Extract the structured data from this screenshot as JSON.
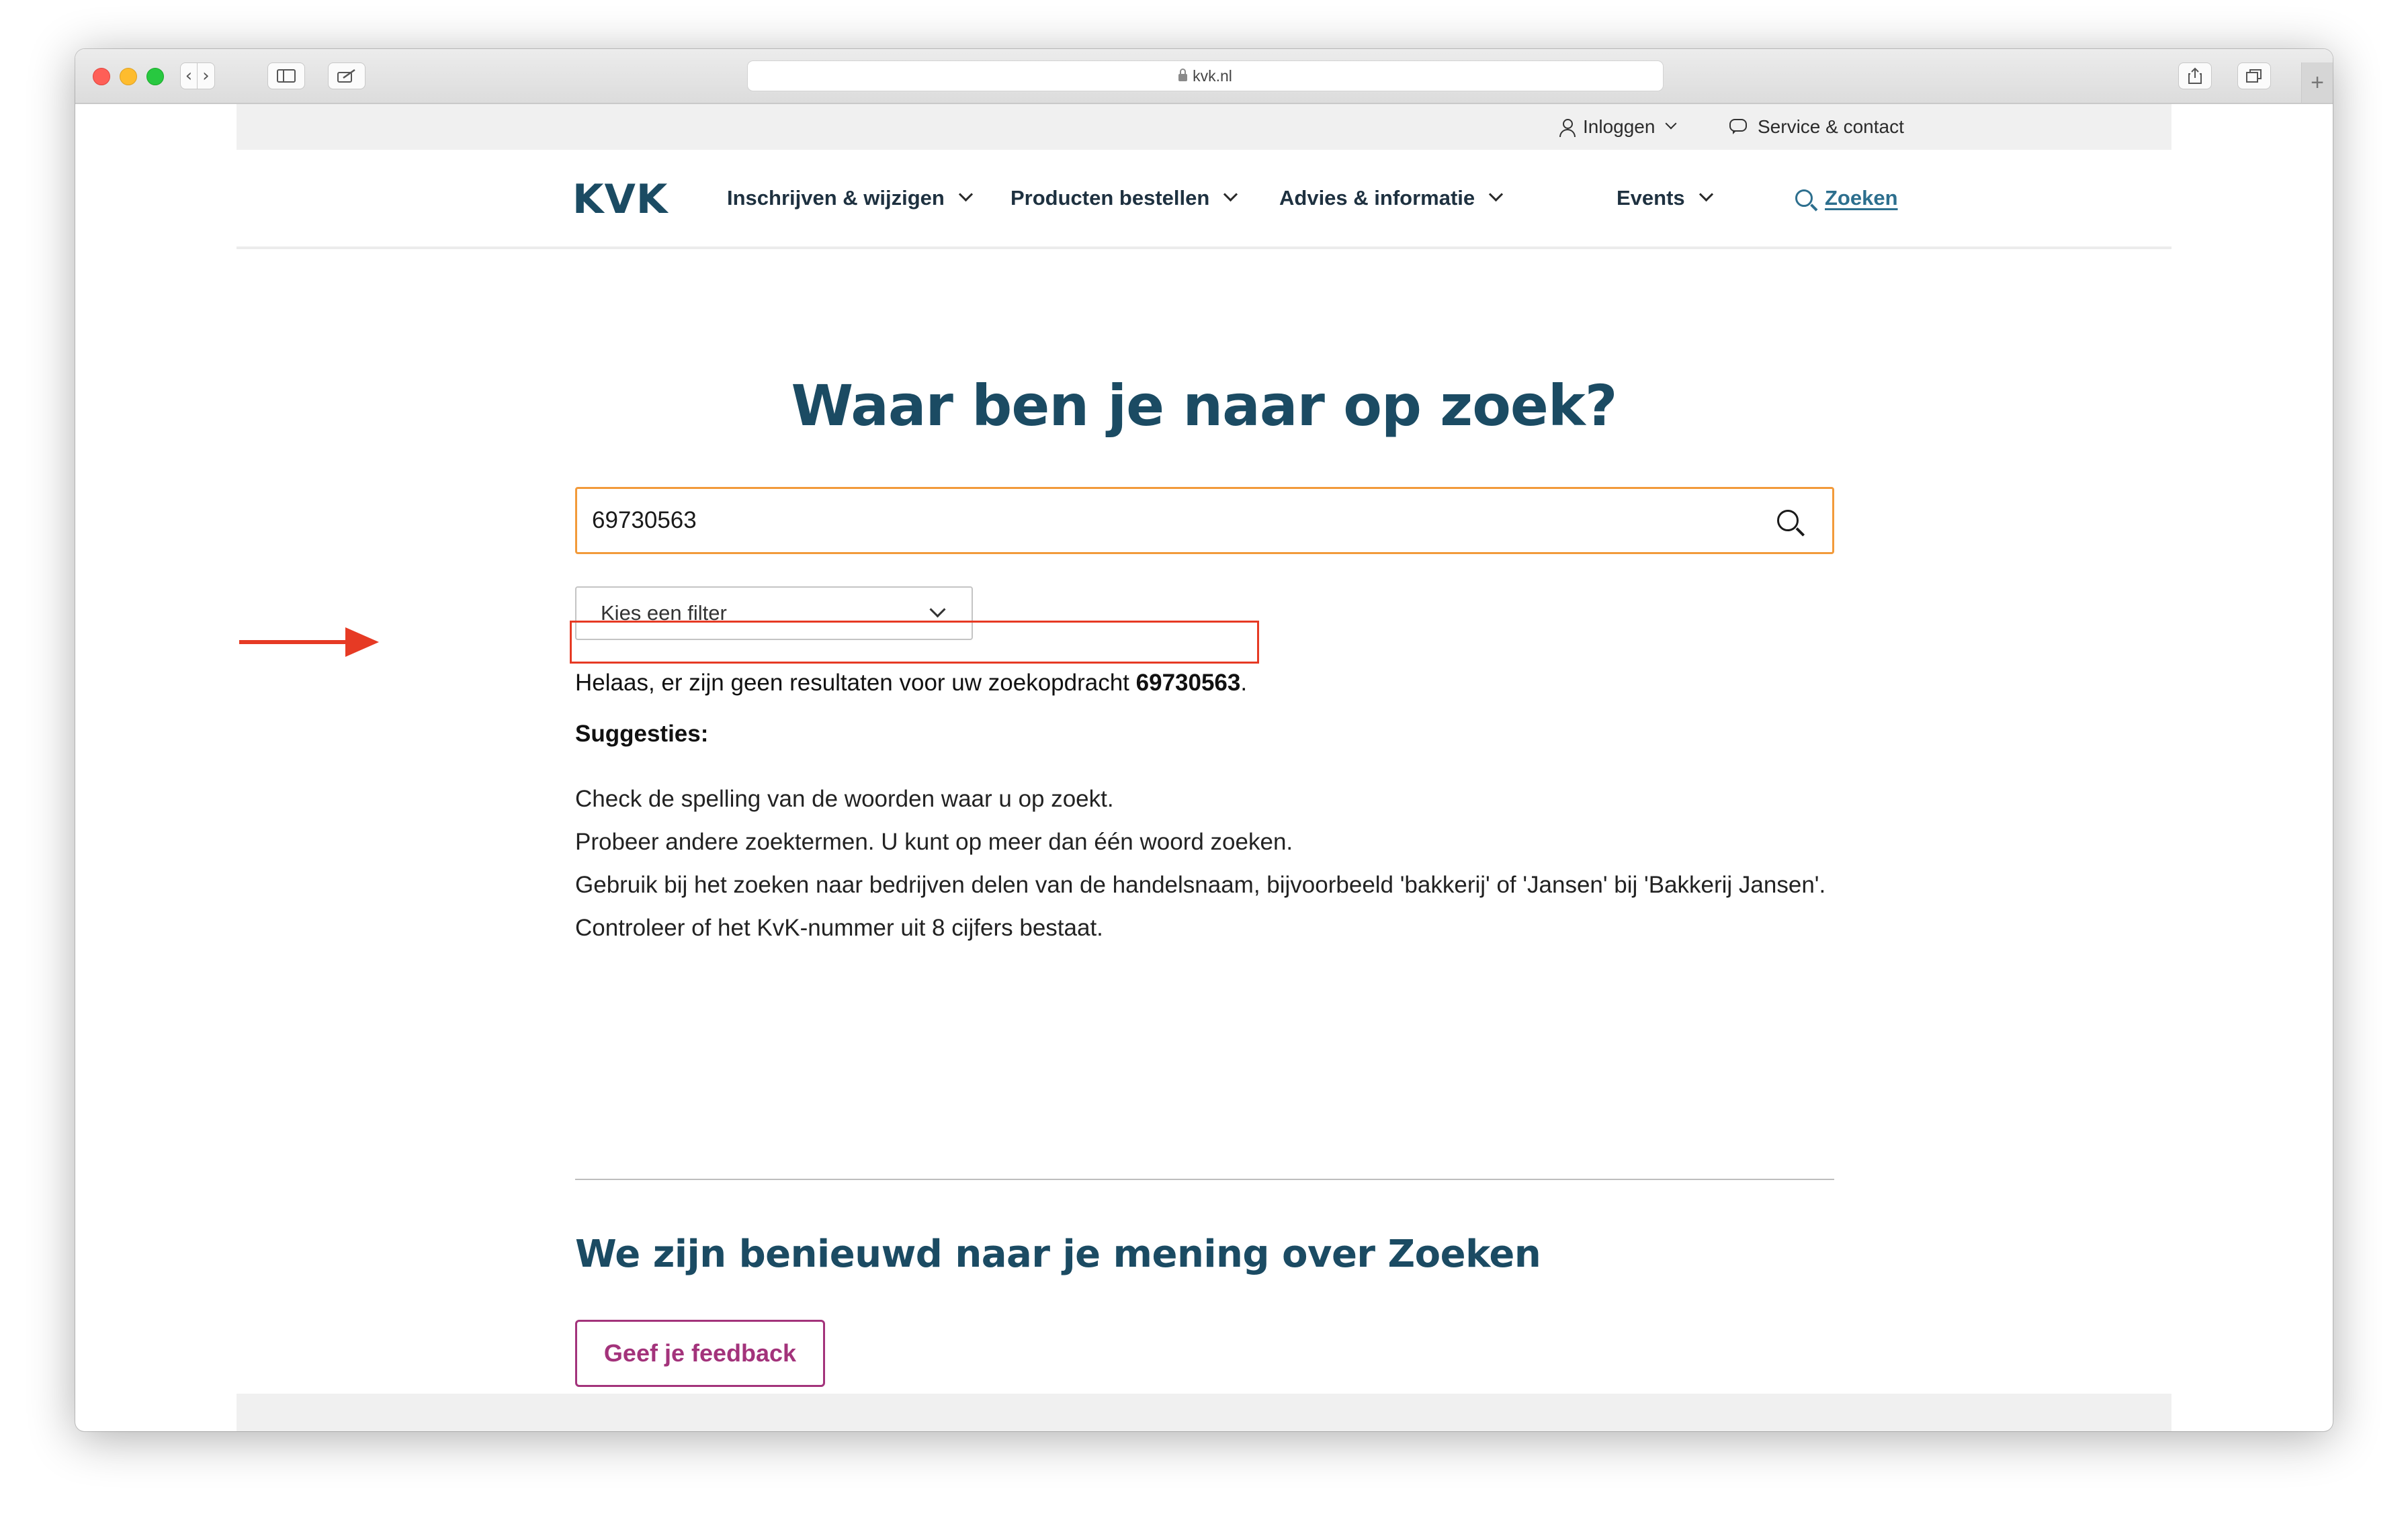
{
  "browser": {
    "url": "kvk.nl",
    "back_glyph": "‹",
    "forward_glyph": "›",
    "new_tab_glyph": "+"
  },
  "topbar": {
    "login_label": "Inloggen",
    "service_label": "Service & contact"
  },
  "nav": {
    "logo": "KVK",
    "items": [
      {
        "label": "Inschrijven & wijzigen"
      },
      {
        "label": "Producten bestellen"
      },
      {
        "label": "Advies & informatie"
      },
      {
        "label": "Events"
      }
    ],
    "search_label": "Zoeken"
  },
  "main": {
    "title": "Waar ben je naar op zoek?",
    "search_value": "69730563",
    "filter_label": "Kies een filter",
    "no_results_prefix": "Helaas, er zijn geen resultaten voor uw zoekopdracht ",
    "no_results_query": "69730563",
    "no_results_suffix": ".",
    "suggestions_title": "Suggesties:",
    "suggestions": [
      "Check de spelling van de woorden waar u op zoekt.",
      "Probeer andere zoektermen. U kunt op meer dan één woord zoeken.",
      "Gebruik bij het zoeken naar bedrijven delen van de handelsnaam, bijvoorbeeld 'bakkerij' of 'Jansen' bij 'Bakkerij Jansen'.",
      "Controleer of het KvK-nummer uit 8 cijfers bestaat."
    ]
  },
  "feedback": {
    "title": "We zijn benieuwd naar je mening over Zoeken",
    "button_label": "Geef je feedback"
  },
  "colors": {
    "brand": "#1b4b63",
    "link": "#2d6f8e",
    "search_border": "#f29a3a",
    "feedback_accent": "#a3337b",
    "annotation": "#e63a24"
  }
}
